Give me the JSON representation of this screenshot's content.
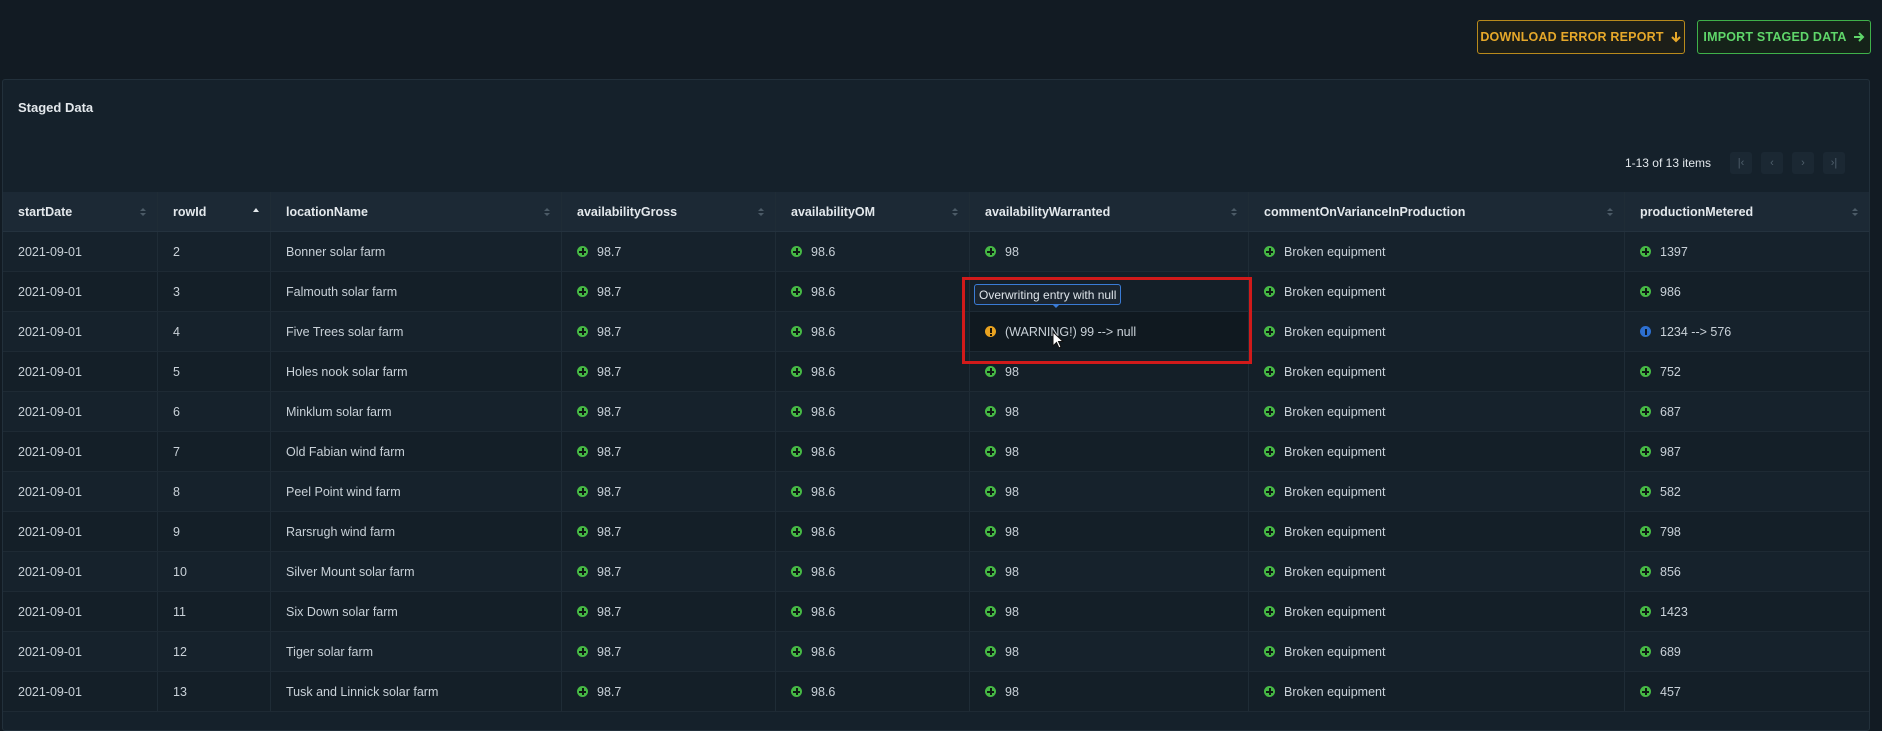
{
  "toolbar": {
    "download_label": "DOWNLOAD ERROR REPORT",
    "import_label": "IMPORT STAGED DATA"
  },
  "panel": {
    "title": "Staged Data",
    "pagination": "1-13 of 13 items"
  },
  "columns": [
    "startDate",
    "rowId",
    "locationName",
    "availabilityGross",
    "availabilityOM",
    "availabilityWarranted",
    "commentOnVarianceInProduction",
    "productionMetered"
  ],
  "rows": [
    {
      "startDate": "2021-09-01",
      "rowId": "2",
      "locationName": "Bonner solar farm",
      "availabilityGross": "98.7",
      "availabilityOM": "98.6",
      "availabilityWarranted": "98",
      "comment": "Broken equipment",
      "productionMetered": "1397"
    },
    {
      "startDate": "2021-09-01",
      "rowId": "3",
      "locationName": "Falmouth solar farm",
      "availabilityGross": "98.7",
      "availabilityOM": "98.6",
      "availabilityWarranted": "",
      "comment": "Broken equipment",
      "productionMetered": "986"
    },
    {
      "startDate": "2021-09-01",
      "rowId": "4",
      "locationName": "Five Trees solar farm",
      "availabilityGross": "98.7",
      "availabilityOM": "98.6",
      "availabilityWarranted": "(WARNING!) 99 --> null",
      "comment": "Broken equipment",
      "productionMetered": "1234 --> 576"
    },
    {
      "startDate": "2021-09-01",
      "rowId": "5",
      "locationName": "Holes nook solar farm",
      "availabilityGross": "98.7",
      "availabilityOM": "98.6",
      "availabilityWarranted": "98",
      "comment": "Broken equipment",
      "productionMetered": "752"
    },
    {
      "startDate": "2021-09-01",
      "rowId": "6",
      "locationName": "Minklum solar farm",
      "availabilityGross": "98.7",
      "availabilityOM": "98.6",
      "availabilityWarranted": "98",
      "comment": "Broken equipment",
      "productionMetered": "687"
    },
    {
      "startDate": "2021-09-01",
      "rowId": "7",
      "locationName": "Old Fabian wind farm",
      "availabilityGross": "98.7",
      "availabilityOM": "98.6",
      "availabilityWarranted": "98",
      "comment": "Broken equipment",
      "productionMetered": "987"
    },
    {
      "startDate": "2021-09-01",
      "rowId": "8",
      "locationName": "Peel Point wind farm",
      "availabilityGross": "98.7",
      "availabilityOM": "98.6",
      "availabilityWarranted": "98",
      "comment": "Broken equipment",
      "productionMetered": "582"
    },
    {
      "startDate": "2021-09-01",
      "rowId": "9",
      "locationName": "Rarsrugh wind farm",
      "availabilityGross": "98.7",
      "availabilityOM": "98.6",
      "availabilityWarranted": "98",
      "comment": "Broken equipment",
      "productionMetered": "798"
    },
    {
      "startDate": "2021-09-01",
      "rowId": "10",
      "locationName": "Silver Mount solar farm",
      "availabilityGross": "98.7",
      "availabilityOM": "98.6",
      "availabilityWarranted": "98",
      "comment": "Broken equipment",
      "productionMetered": "856"
    },
    {
      "startDate": "2021-09-01",
      "rowId": "11",
      "locationName": "Six Down solar farm",
      "availabilityGross": "98.7",
      "availabilityOM": "98.6",
      "availabilityWarranted": "98",
      "comment": "Broken equipment",
      "productionMetered": "1423"
    },
    {
      "startDate": "2021-09-01",
      "rowId": "12",
      "locationName": "Tiger solar farm",
      "availabilityGross": "98.7",
      "availabilityOM": "98.6",
      "availabilityWarranted": "98",
      "comment": "Broken equipment",
      "productionMetered": "689"
    },
    {
      "startDate": "2021-09-01",
      "rowId": "13",
      "locationName": "Tusk and Linnick solar farm",
      "availabilityGross": "98.7",
      "availabilityOM": "98.6",
      "availabilityWarranted": "98",
      "comment": "Broken equipment",
      "productionMetered": "457"
    }
  ],
  "tooltip": "Overwriting entry with null",
  "colors": {
    "background": "#121b23",
    "success": "#46b945",
    "warning": "#e9a320",
    "info": "#2d6fd0",
    "highlight": "#d11a1a",
    "download_accent": "#e6a82a",
    "import_accent": "#5fd66a"
  },
  "icons": {
    "download": "arrow-down-icon",
    "import": "arrow-right-icon",
    "valid": "plus-circle-icon",
    "warning": "exclamation-circle-icon",
    "changed": "info-circle-icon"
  }
}
